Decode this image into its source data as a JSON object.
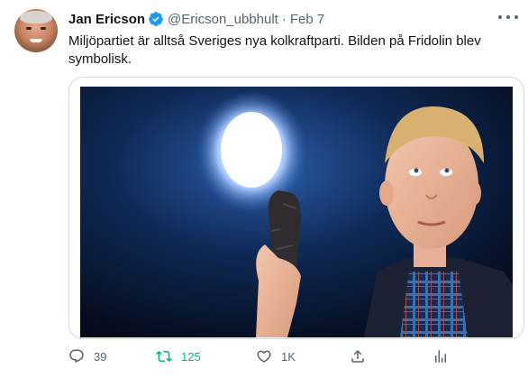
{
  "tweet": {
    "author_name": "Jan Ericson",
    "handle": "@Ericson_ubbhult",
    "separator": "·",
    "date": "Feb 7",
    "text": "Miljöpartiet är alltså Sveriges nya kolkraftparti. Bilden på Fridolin blev symbolisk.",
    "verified": true
  },
  "actions": {
    "reply_count": "39",
    "retweet_count": "125",
    "like_count": "1K",
    "retweeted": true
  },
  "icons": {
    "avatar": "avatar-image",
    "verified": "verified-badge-icon",
    "more": "more-options-icon",
    "reply": "reply-icon",
    "retweet": "retweet-icon",
    "like": "heart-icon",
    "share": "share-icon",
    "analytics": "analytics-icon"
  },
  "colors": {
    "verified": "#1d9bf0",
    "retweet_active": "#00ba7c",
    "secondary_text": "#536471",
    "primary_text": "#0f1419"
  }
}
